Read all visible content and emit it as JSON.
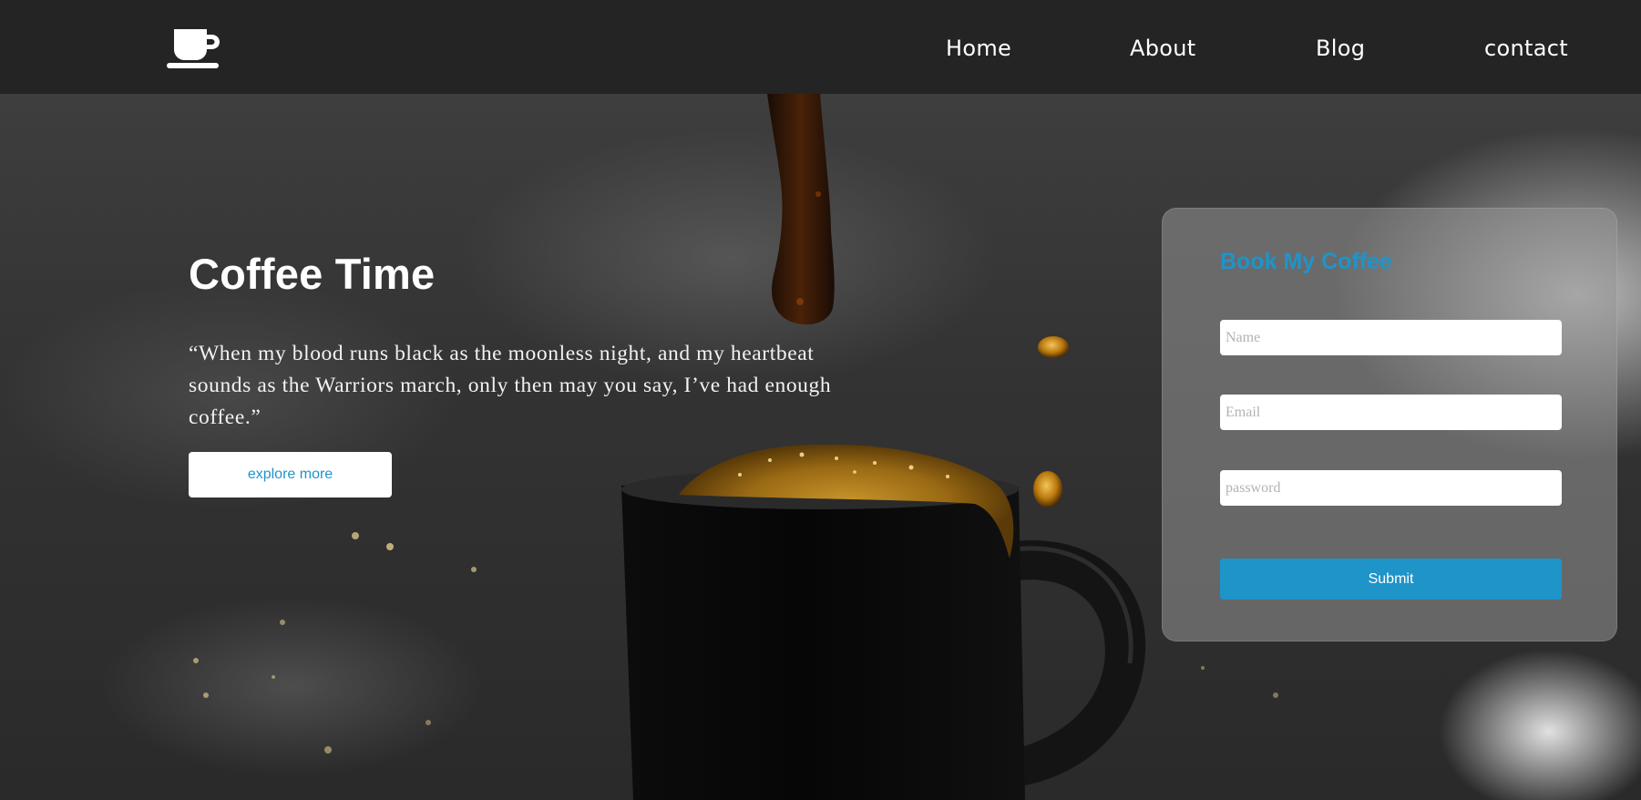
{
  "nav": {
    "logo_icon": "coffee-cup-icon",
    "links": [
      "Home",
      "About",
      "Blog",
      "contact"
    ]
  },
  "hero": {
    "title": "Coffee Time",
    "quote": "“When my blood runs black as the moonless night, and my heartbeat sounds as the Warriors march, only then may you say, I’ve had enough coffee.”",
    "explore_label": "explore more"
  },
  "booking": {
    "title": "Book My Coffee",
    "name_placeholder": "Name",
    "email_placeholder": "Email",
    "password_placeholder": "password",
    "submit_label": "Submit"
  },
  "colors": {
    "navbar": "#242424",
    "accent": "#1f94c9",
    "text_light": "#ffffff"
  }
}
